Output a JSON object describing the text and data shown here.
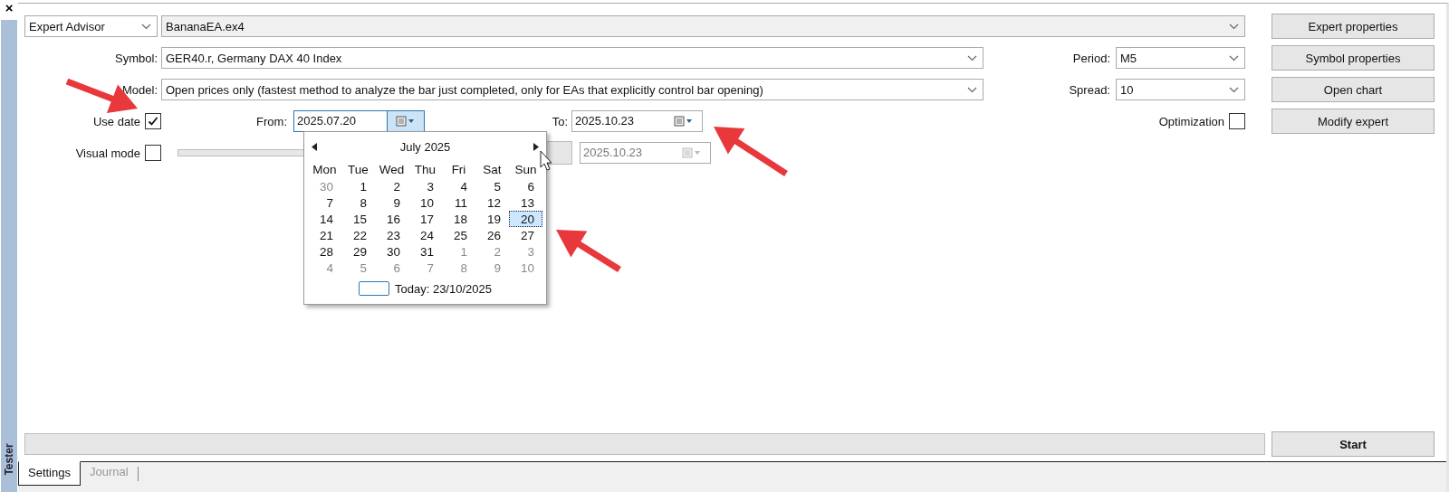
{
  "side_panel": {
    "close": "×",
    "title": "Tester"
  },
  "expert_type": {
    "value": "Expert Advisor"
  },
  "expert": {
    "value": "BananaEA.ex4"
  },
  "symbol": {
    "label": "Symbol:",
    "value": "GER40.r, Germany DAX 40 Index"
  },
  "model": {
    "label": "Model:",
    "value": "Open prices only (fastest method to analyze the bar just completed, only for EAs that explicitly control bar opening)"
  },
  "period": {
    "label": "Period:",
    "value": "M5"
  },
  "spread": {
    "label": "Spread:",
    "value": "10"
  },
  "use_date": {
    "label": "Use date",
    "checked": true
  },
  "from": {
    "label": "From:",
    "value": "2025.07.20",
    "expanded": true
  },
  "to": {
    "label": "To:",
    "value": "2025.10.23",
    "expanded": false
  },
  "optimization": {
    "label": "Optimization",
    "checked": false
  },
  "visual_mode": {
    "label": "Visual mode",
    "checked": false
  },
  "skip_to": {
    "value": "2025.10.23",
    "disabled": true
  },
  "buttons": [
    "Expert properties",
    "Symbol properties",
    "Open chart",
    "Modify expert"
  ],
  "calendar": {
    "month": "July 2025",
    "weekdays": [
      "Mon",
      "Tue",
      "Wed",
      "Thu",
      "Fri",
      "Sat",
      "Sun"
    ],
    "weeks": [
      [
        {
          "day": "30",
          "muted": true,
          "selected": false
        },
        {
          "day": "1",
          "muted": false,
          "selected": false
        },
        {
          "day": "2",
          "muted": false,
          "selected": false
        },
        {
          "day": "3",
          "muted": false,
          "selected": false
        },
        {
          "day": "4",
          "muted": false,
          "selected": false
        },
        {
          "day": "5",
          "muted": false,
          "selected": false
        },
        {
          "day": "6",
          "muted": false,
          "selected": false
        }
      ],
      [
        {
          "day": "7",
          "muted": false,
          "selected": false
        },
        {
          "day": "8",
          "muted": false,
          "selected": false
        },
        {
          "day": "9",
          "muted": false,
          "selected": false
        },
        {
          "day": "10",
          "muted": false,
          "selected": false
        },
        {
          "day": "11",
          "muted": false,
          "selected": false
        },
        {
          "day": "12",
          "muted": false,
          "selected": false
        },
        {
          "day": "13",
          "muted": false,
          "selected": false
        }
      ],
      [
        {
          "day": "14",
          "muted": false,
          "selected": false
        },
        {
          "day": "15",
          "muted": false,
          "selected": false
        },
        {
          "day": "16",
          "muted": false,
          "selected": false
        },
        {
          "day": "17",
          "muted": false,
          "selected": false
        },
        {
          "day": "18",
          "muted": false,
          "selected": false
        },
        {
          "day": "19",
          "muted": false,
          "selected": false
        },
        {
          "day": "20",
          "muted": false,
          "selected": true
        }
      ],
      [
        {
          "day": "21",
          "muted": false,
          "selected": false
        },
        {
          "day": "22",
          "muted": false,
          "selected": false
        },
        {
          "day": "23",
          "muted": false,
          "selected": false
        },
        {
          "day": "24",
          "muted": false,
          "selected": false
        },
        {
          "day": "25",
          "muted": false,
          "selected": false
        },
        {
          "day": "26",
          "muted": false,
          "selected": false
        },
        {
          "day": "27",
          "muted": false,
          "selected": false
        }
      ],
      [
        {
          "day": "28",
          "muted": false,
          "selected": false
        },
        {
          "day": "29",
          "muted": false,
          "selected": false
        },
        {
          "day": "30",
          "muted": false,
          "selected": false
        },
        {
          "day": "31",
          "muted": false,
          "selected": false
        },
        {
          "day": "1",
          "muted": true,
          "selected": false
        },
        {
          "day": "2",
          "muted": true,
          "selected": false
        },
        {
          "day": "3",
          "muted": true,
          "selected": false
        }
      ],
      [
        {
          "day": "4",
          "muted": true,
          "selected": false
        },
        {
          "day": "5",
          "muted": true,
          "selected": false
        },
        {
          "day": "6",
          "muted": true,
          "selected": false
        },
        {
          "day": "7",
          "muted": true,
          "selected": false
        },
        {
          "day": "8",
          "muted": true,
          "selected": false
        },
        {
          "day": "9",
          "muted": true,
          "selected": false
        },
        {
          "day": "10",
          "muted": true,
          "selected": false
        }
      ]
    ],
    "today": "Today: 23/10/2025"
  },
  "start_button": "Start",
  "tabs": [
    {
      "label": "Settings",
      "selected": true
    },
    {
      "label": "Journal",
      "selected": false
    }
  ]
}
